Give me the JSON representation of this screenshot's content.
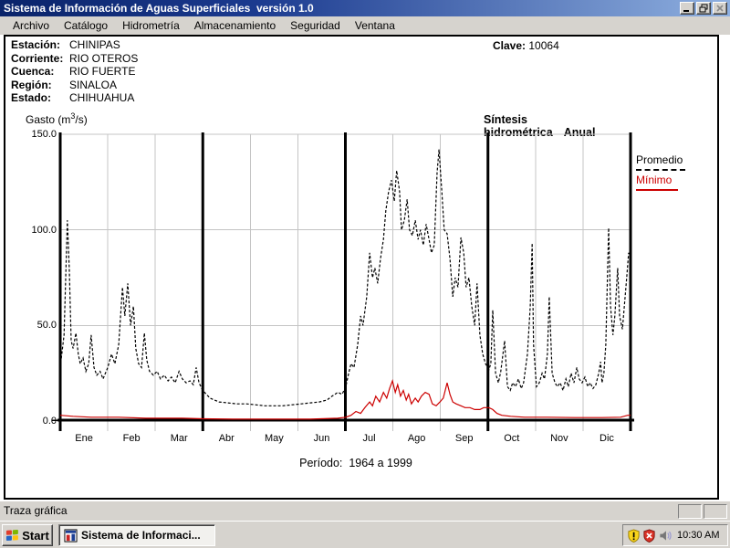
{
  "window": {
    "title": "Sistema de Información de Aguas Superficiales  versión 1.0"
  },
  "menu": {
    "items": [
      "Archivo",
      "Catálogo",
      "Hidrometría",
      "Almacenamiento",
      "Seguridad",
      "Ventana"
    ]
  },
  "station": {
    "fields": [
      {
        "label": "Estación:",
        "value": "CHINIPAS"
      },
      {
        "label": "Corriente:",
        "value": "RIO OTEROS"
      },
      {
        "label": "Cuenca:",
        "value": "RIO FUERTE"
      },
      {
        "label": "Región:",
        "value": "SINALOA"
      },
      {
        "label": "Estado:",
        "value": "CHIHUAHUA"
      }
    ],
    "clave_label": "Clave:",
    "clave_value": "10064"
  },
  "chart_header": {
    "gasto_prefix": "Gasto (m",
    "gasto_sup": "3",
    "gasto_suffix": "/s)",
    "title": "Síntesis hidrométrica",
    "mode": "Anual"
  },
  "legend": {
    "promedio": "Promedio",
    "minimo": "Mínimo",
    "promedio_color": "#000000",
    "minimo_color": "#cc0000"
  },
  "caption": {
    "periodo": "Período:  1964 a 1999"
  },
  "statusbar": {
    "text": "Traza gráfica"
  },
  "taskbar": {
    "start_label": "Start",
    "task_label": "Sistema de Informaci...",
    "clock": "10:30 AM"
  },
  "chart_data": {
    "type": "line",
    "title": "Síntesis hidrométrica Anual",
    "ylabel": "Gasto (m3/s)",
    "caption": "Período: 1964 a 1999",
    "ylim": [
      0,
      150
    ],
    "ytick_values": [
      150,
      100,
      50,
      0
    ],
    "ytick_labels": [
      "150.0",
      "100.0",
      "50.0",
      "0.0"
    ],
    "months": [
      "Ene",
      "Feb",
      "Mar",
      "Abr",
      "May",
      "Jun",
      "Jul",
      "Ago",
      "Sep",
      "Oct",
      "Nov",
      "Dic"
    ],
    "x_unit": "month_fraction_0_to_12",
    "grid": true,
    "quarter_divider_months": [
      0,
      3,
      6,
      9,
      12
    ],
    "minor_gridline_months": [
      1,
      2,
      4,
      5,
      7,
      8,
      10,
      11
    ],
    "legend_position": "right",
    "series": [
      {
        "name": "Promedio",
        "color": "#000000",
        "style": "dashed",
        "points": [
          [
            0,
            28
          ],
          [
            0.08,
            45
          ],
          [
            0.15,
            105
          ],
          [
            0.19,
            80
          ],
          [
            0.23,
            42
          ],
          [
            0.27,
            38
          ],
          [
            0.33,
            46
          ],
          [
            0.38,
            35
          ],
          [
            0.42,
            30
          ],
          [
            0.48,
            33
          ],
          [
            0.54,
            26
          ],
          [
            0.6,
            30
          ],
          [
            0.65,
            45
          ],
          [
            0.71,
            28
          ],
          [
            0.77,
            24
          ],
          [
            0.84,
            26
          ],
          [
            0.9,
            22
          ],
          [
            1,
            28
          ],
          [
            1.08,
            35
          ],
          [
            1.15,
            30
          ],
          [
            1.23,
            40
          ],
          [
            1.31,
            70
          ],
          [
            1.36,
            55
          ],
          [
            1.42,
            72
          ],
          [
            1.48,
            50
          ],
          [
            1.54,
            60
          ],
          [
            1.59,
            38
          ],
          [
            1.65,
            30
          ],
          [
            1.71,
            28
          ],
          [
            1.77,
            46
          ],
          [
            1.82,
            32
          ],
          [
            1.88,
            26
          ],
          [
            1.96,
            24
          ],
          [
            2.04,
            26
          ],
          [
            2.11,
            22
          ],
          [
            2.19,
            24
          ],
          [
            2.27,
            21
          ],
          [
            2.34,
            23
          ],
          [
            2.42,
            20
          ],
          [
            2.5,
            26
          ],
          [
            2.57,
            22
          ],
          [
            2.65,
            20
          ],
          [
            2.73,
            21
          ],
          [
            2.8,
            19
          ],
          [
            2.86,
            28
          ],
          [
            2.92,
            20
          ],
          [
            3,
            16
          ],
          [
            3.15,
            12
          ],
          [
            3.34,
            10
          ],
          [
            3.53,
            9.5
          ],
          [
            3.72,
            9
          ],
          [
            3.92,
            9
          ],
          [
            4.11,
            8.5
          ],
          [
            4.3,
            8
          ],
          [
            4.49,
            8
          ],
          [
            4.68,
            8
          ],
          [
            4.88,
            8.5
          ],
          [
            5.07,
            9
          ],
          [
            5.26,
            9.5
          ],
          [
            5.45,
            10
          ],
          [
            5.61,
            11
          ],
          [
            5.72,
            13
          ],
          [
            5.84,
            15
          ],
          [
            5.93,
            14
          ],
          [
            6.01,
            18
          ],
          [
            6.07,
            25
          ],
          [
            6.12,
            30
          ],
          [
            6.18,
            28
          ],
          [
            6.26,
            40
          ],
          [
            6.32,
            55
          ],
          [
            6.37,
            50
          ],
          [
            6.45,
            65
          ],
          [
            6.51,
            88
          ],
          [
            6.57,
            75
          ],
          [
            6.62,
            80
          ],
          [
            6.68,
            72
          ],
          [
            6.74,
            85
          ],
          [
            6.8,
            95
          ],
          [
            6.85,
            110
          ],
          [
            6.91,
            120
          ],
          [
            6.97,
            126
          ],
          [
            7.03,
            115
          ],
          [
            7.08,
            131
          ],
          [
            7.14,
            120
          ],
          [
            7.18,
            100
          ],
          [
            7.24,
            105
          ],
          [
            7.3,
            116
          ],
          [
            7.35,
            100
          ],
          [
            7.41,
            97
          ],
          [
            7.47,
            105
          ],
          [
            7.53,
            95
          ],
          [
            7.58,
            100
          ],
          [
            7.64,
            92
          ],
          [
            7.7,
            103
          ],
          [
            7.76,
            95
          ],
          [
            7.81,
            88
          ],
          [
            7.87,
            92
          ],
          [
            7.93,
            130
          ],
          [
            7.97,
            142
          ],
          [
            8.03,
            120
          ],
          [
            8.08,
            100
          ],
          [
            8.14,
            98
          ],
          [
            8.2,
            85
          ],
          [
            8.26,
            65
          ],
          [
            8.31,
            75
          ],
          [
            8.37,
            70
          ],
          [
            8.43,
            96
          ],
          [
            8.49,
            88
          ],
          [
            8.54,
            70
          ],
          [
            8.6,
            75
          ],
          [
            8.66,
            60
          ],
          [
            8.72,
            50
          ],
          [
            8.77,
            72
          ],
          [
            8.83,
            45
          ],
          [
            8.89,
            35
          ],
          [
            8.95,
            30
          ],
          [
            9.02,
            27
          ],
          [
            9.06,
            30
          ],
          [
            9.1,
            58
          ],
          [
            9.16,
            25
          ],
          [
            9.22,
            20
          ],
          [
            9.27,
            26
          ],
          [
            9.35,
            42
          ],
          [
            9.41,
            18
          ],
          [
            9.47,
            16
          ],
          [
            9.52,
            20
          ],
          [
            9.58,
            18
          ],
          [
            9.64,
            22
          ],
          [
            9.7,
            17
          ],
          [
            9.75,
            20
          ],
          [
            9.83,
            35
          ],
          [
            9.89,
            60
          ],
          [
            9.93,
            93
          ],
          [
            9.96,
            40
          ],
          [
            10.02,
            18
          ],
          [
            10.08,
            20
          ],
          [
            10.14,
            25
          ],
          [
            10.19,
            22
          ],
          [
            10.25,
            35
          ],
          [
            10.29,
            65
          ],
          [
            10.35,
            25
          ],
          [
            10.41,
            20
          ],
          [
            10.46,
            18
          ],
          [
            10.52,
            20
          ],
          [
            10.58,
            16
          ],
          [
            10.64,
            22
          ],
          [
            10.69,
            18
          ],
          [
            10.75,
            25
          ],
          [
            10.81,
            20
          ],
          [
            10.87,
            28
          ],
          [
            10.92,
            22
          ],
          [
            10.98,
            20
          ],
          [
            11.04,
            23
          ],
          [
            11.1,
            18
          ],
          [
            11.15,
            20
          ],
          [
            11.21,
            17
          ],
          [
            11.27,
            19
          ],
          [
            11.33,
            25
          ],
          [
            11.37,
            31
          ],
          [
            11.4,
            20
          ],
          [
            11.44,
            25
          ],
          [
            11.48,
            40
          ],
          [
            11.54,
            101
          ],
          [
            11.58,
            60
          ],
          [
            11.63,
            45
          ],
          [
            11.67,
            55
          ],
          [
            11.73,
            80
          ],
          [
            11.77,
            55
          ],
          [
            11.83,
            48
          ],
          [
            11.87,
            60
          ],
          [
            11.92,
            75
          ],
          [
            11.96,
            88
          ],
          [
            12,
            85
          ]
        ]
      },
      {
        "name": "Mínimo",
        "color": "#cc0000",
        "style": "solid",
        "points": [
          [
            0,
            3
          ],
          [
            0.27,
            2.5
          ],
          [
            0.65,
            2
          ],
          [
            1.23,
            2
          ],
          [
            1.8,
            1.5
          ],
          [
            2.57,
            1.5
          ],
          [
            3,
            1.2
          ],
          [
            3.72,
            1
          ],
          [
            4.49,
            1
          ],
          [
            5.26,
            1
          ],
          [
            5.84,
            1.5
          ],
          [
            6.01,
            2
          ],
          [
            6.12,
            3
          ],
          [
            6.22,
            5
          ],
          [
            6.32,
            4
          ],
          [
            6.41,
            7
          ],
          [
            6.51,
            10
          ],
          [
            6.57,
            8
          ],
          [
            6.64,
            13
          ],
          [
            6.72,
            10
          ],
          [
            6.8,
            15
          ],
          [
            6.87,
            12
          ],
          [
            6.93,
            17
          ],
          [
            6.99,
            21
          ],
          [
            7.05,
            15
          ],
          [
            7.1,
            19
          ],
          [
            7.16,
            13
          ],
          [
            7.22,
            16
          ],
          [
            7.28,
            11
          ],
          [
            7.33,
            14
          ],
          [
            7.39,
            9
          ],
          [
            7.47,
            12
          ],
          [
            7.53,
            10
          ],
          [
            7.6,
            13
          ],
          [
            7.68,
            15
          ],
          [
            7.76,
            14
          ],
          [
            7.83,
            9
          ],
          [
            7.91,
            8
          ],
          [
            7.99,
            10
          ],
          [
            8.06,
            12
          ],
          [
            8.14,
            20
          ],
          [
            8.2,
            14
          ],
          [
            8.26,
            10
          ],
          [
            8.33,
            9
          ],
          [
            8.43,
            8
          ],
          [
            8.52,
            7
          ],
          [
            8.62,
            7
          ],
          [
            8.72,
            6
          ],
          [
            8.83,
            6
          ],
          [
            8.91,
            7
          ],
          [
            9.02,
            7
          ],
          [
            9.1,
            6
          ],
          [
            9.19,
            4
          ],
          [
            9.29,
            3
          ],
          [
            9.48,
            2.5
          ],
          [
            9.77,
            2
          ],
          [
            10.25,
            2
          ],
          [
            10.83,
            1.8
          ],
          [
            11.4,
            1.8
          ],
          [
            11.79,
            2
          ],
          [
            11.94,
            3
          ],
          [
            12,
            3
          ]
        ]
      }
    ]
  }
}
